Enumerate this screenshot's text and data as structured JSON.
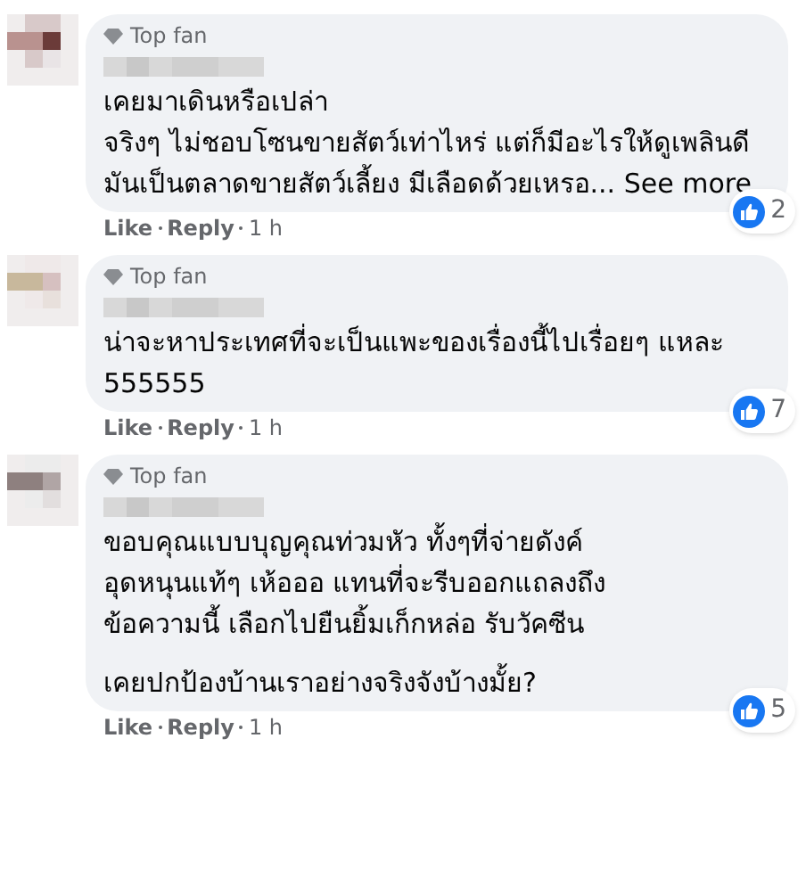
{
  "comments": [
    {
      "badge": "Top fan",
      "paragraphs": [
        "เคยมาเดินหรือเปล่า\nจริงๆ ไม่ชอบโซนขายสัตว์เท่าไหร่ แต่ก็มีอะไรให้ดูเพลินดี\nมันเป็นตลาดขายสัตว์เลี้ยง มีเลือดด้วยเหรอ... See more"
      ],
      "reactions": "2",
      "actions": [
        "Like",
        "Reply",
        "1 h"
      ]
    },
    {
      "badge": "Top fan",
      "paragraphs": [
        "น่าจะหาประเทศที่จะเป็นแพะของเรื่องนี้ไปเรื่อยๆ แหละ 555555"
      ],
      "reactions": "7",
      "actions": [
        "Like",
        "Reply",
        "1 h"
      ]
    },
    {
      "badge": "Top fan",
      "paragraphs": [
        "ขอบคุณแบบบุญคุณท่วมหัว ทั้งๆที่จ่ายดังค์\nอุดหนุนแท้ๆ เห้อออ แทนที่จะรีบออกแถลงถึง\nข้อความนี้ เลือกไปยืนยิ้มเก็กหล่อ รับวัคซีน",
        "เคยปกป้องบ้านเราอย่างจริงจังบ้างมั้ย?"
      ],
      "reactions": "5",
      "actions": [
        "Like",
        "Reply",
        "1 h"
      ]
    }
  ]
}
